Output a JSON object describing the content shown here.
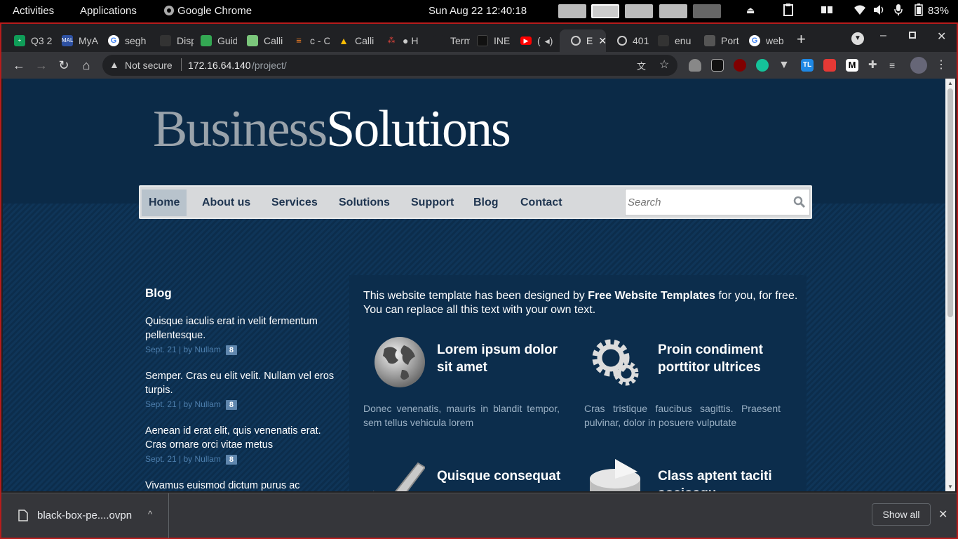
{
  "system_bar": {
    "activities": "Activities",
    "applications": "Applications",
    "app_name": "Google Chrome",
    "clock": "Sun Aug 22  12:40:18",
    "battery": "83%"
  },
  "browser": {
    "tabs": [
      {
        "label": "Q3 2",
        "color": "#0f9d58"
      },
      {
        "label": "MyA",
        "color": "#2e51a2"
      },
      {
        "label": "segh",
        "color": "#4285f4"
      },
      {
        "label": "Disp",
        "color": "#333333"
      },
      {
        "label": "Guid",
        "color": "#34a853"
      },
      {
        "label": "Calli",
        "color": "#7bc67b"
      },
      {
        "label": "c - C",
        "color": "#f48024"
      },
      {
        "label": "Calli",
        "color": "#fbbc04"
      },
      {
        "label": "● H",
        "color": "#e8453c"
      },
      {
        "label": "Term",
        "color": "#202124"
      },
      {
        "label": "INE",
        "color": "#111111"
      },
      {
        "label": "(",
        "color": "#ff0000"
      },
      {
        "label": "E",
        "color": "#5f6368"
      },
      {
        "label": "401",
        "color": "#5f6368"
      },
      {
        "label": "enu",
        "color": "#333333"
      },
      {
        "label": "Port",
        "color": "#555555"
      },
      {
        "label": "web",
        "color": "#4285f4"
      }
    ],
    "address": {
      "security": "Not secure",
      "host": "172.16.64.140",
      "path": "/project/"
    }
  },
  "site": {
    "logo_part1": "Business",
    "logo_part2": "Solutions",
    "nav": [
      "Home",
      "About us",
      "Services",
      "Solutions",
      "Support",
      "Blog",
      "Contact"
    ],
    "search_placeholder": "Search",
    "blog": {
      "title": "Blog",
      "posts": [
        {
          "title": "Quisque iaculis erat in velit fermentum pellentesque.",
          "meta": "Sept. 21 | by Nullam",
          "count": "8"
        },
        {
          "title": "Semper. Cras eu elit velit. Nullam vel eros turpis.",
          "meta": "Sept. 21 | by Nullam",
          "count": "8"
        },
        {
          "title": "Aenean id erat elit, quis venenatis erat. Cras ornare orci vitae metus",
          "meta": "Sept. 21 | by Nullam",
          "count": "8"
        },
        {
          "title": "Vivamus euismod dictum purus ac semper.",
          "meta": "",
          "count": ""
        }
      ]
    },
    "intro_pre": "This website template has been designed by ",
    "intro_bold": "Free Website Templates",
    "intro_post": " for you, for free. You can replace all this text with your own text.",
    "features": [
      {
        "title": "Lorem ipsum dolor sit amet",
        "desc": "Donec venenatis, mauris in blandit tempor, sem tellus vehicula lorem",
        "icon": "globe-icon"
      },
      {
        "title": "Proin condiment porttitor ultrices",
        "desc": "Cras tristique faucibus sagittis. Praesent pulvinar, dolor in posuere vulputate",
        "icon": "gears-icon"
      },
      {
        "title": "Quisque consequat",
        "desc": "",
        "icon": "checkmark-icon"
      },
      {
        "title": "Class aptent taciti sociosqu",
        "desc": "",
        "icon": "pie-chart-icon"
      }
    ]
  },
  "downloads": {
    "file": "black-box-pe....ovpn",
    "show_all": "Show all"
  }
}
